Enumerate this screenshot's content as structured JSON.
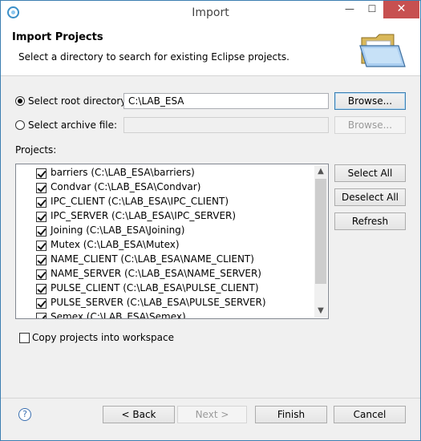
{
  "window": {
    "title": "Import",
    "minimize": "—",
    "maximize": "☐",
    "close": "✕"
  },
  "banner": {
    "title": "Import Projects",
    "description": "Select a directory to search for existing Eclipse projects."
  },
  "root_directory": {
    "label": "Select root directory:",
    "selected": true,
    "value": "C:\\LAB_ESA",
    "browse_label": "Browse..."
  },
  "archive_file": {
    "label": "Select archive file:",
    "selected": false,
    "value": "",
    "browse_label": "Browse..."
  },
  "projects": {
    "label": "Projects:",
    "items": [
      {
        "label": "barriers (C:\\LAB_ESA\\barriers)",
        "checked": true
      },
      {
        "label": "Condvar (C:\\LAB_ESA\\Condvar)",
        "checked": true
      },
      {
        "label": "IPC_CLIENT (C:\\LAB_ESA\\IPC_CLIENT)",
        "checked": true
      },
      {
        "label": "IPC_SERVER (C:\\LAB_ESA\\IPC_SERVER)",
        "checked": true
      },
      {
        "label": "Joining (C:\\LAB_ESA\\Joining)",
        "checked": true
      },
      {
        "label": "Mutex (C:\\LAB_ESA\\Mutex)",
        "checked": true
      },
      {
        "label": "NAME_CLIENT (C:\\LAB_ESA\\NAME_CLIENT)",
        "checked": true
      },
      {
        "label": "NAME_SERVER (C:\\LAB_ESA\\NAME_SERVER)",
        "checked": true
      },
      {
        "label": "PULSE_CLIENT (C:\\LAB_ESA\\PULSE_CLIENT)",
        "checked": true
      },
      {
        "label": "PULSE_SERVER (C:\\LAB_ESA\\PULSE_SERVER)",
        "checked": true
      },
      {
        "label": "Semex (C:\\LAB_ESA\\Semex)",
        "checked": true
      }
    ],
    "select_all": "Select All",
    "deselect_all": "Deselect All",
    "refresh": "Refresh"
  },
  "copy_projects": {
    "label": "Copy projects into workspace",
    "checked": false
  },
  "footer": {
    "back": "< Back",
    "next": "Next >",
    "finish": "Finish",
    "cancel": "Cancel",
    "help_icon": "?"
  }
}
